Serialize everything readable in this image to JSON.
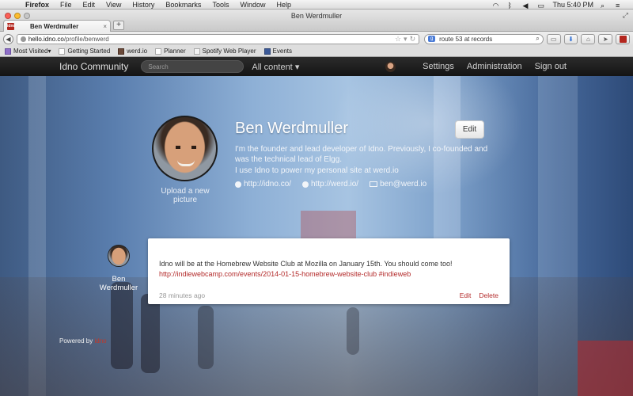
{
  "menubar": {
    "app": "Firefox",
    "items": [
      "File",
      "Edit",
      "View",
      "History",
      "Bookmarks",
      "Tools",
      "Window",
      "Help"
    ],
    "clock": "Thu 5:40 PM"
  },
  "window": {
    "title": "Ben Werdmuller"
  },
  "tab": {
    "title": "Ben Werdmuller",
    "favicon_text": "idno"
  },
  "toolbar": {
    "url_host": "hello.idno.co",
    "url_path": "/profile/benwerd",
    "search_value": "route 53 at records"
  },
  "bookmarks": [
    "Most Visited",
    "Getting Started",
    "werd.io",
    "Planner",
    "Spotify Web Player",
    "Events"
  ],
  "site": {
    "brand": "Idno Community",
    "search_placeholder": "Search",
    "all_content": "All content",
    "nav": [
      "Settings",
      "Administration",
      "Sign out"
    ]
  },
  "profile": {
    "name": "Ben Werdmuller",
    "edit_label": "Edit",
    "upload_label": "Upload a new picture",
    "bio_1": "I'm the founder and lead developer of Idno. Previously, I co-founded and was the technical lead of Elgg.",
    "bio_2": "I use Idno to power my personal site at werd.io",
    "links": [
      "http://idno.co/",
      "http://werd.io/",
      "ben@werd.io"
    ]
  },
  "post": {
    "author": "Ben Werdmuller",
    "text": "Idno will be at the Homebrew Website Club at Mozilla on January 15th. You should come too!",
    "link": "http://indiewebcamp.com/events/2014-01-15-homebrew-website-club",
    "tag": "#indieweb",
    "time": "28 minutes ago",
    "edit": "Edit",
    "delete": "Delete"
  },
  "footer": {
    "powered": "Powered by",
    "powered_link": "idno"
  },
  "colors": {
    "accent": "#b32a2a",
    "navbar": "#1c1c1c"
  }
}
